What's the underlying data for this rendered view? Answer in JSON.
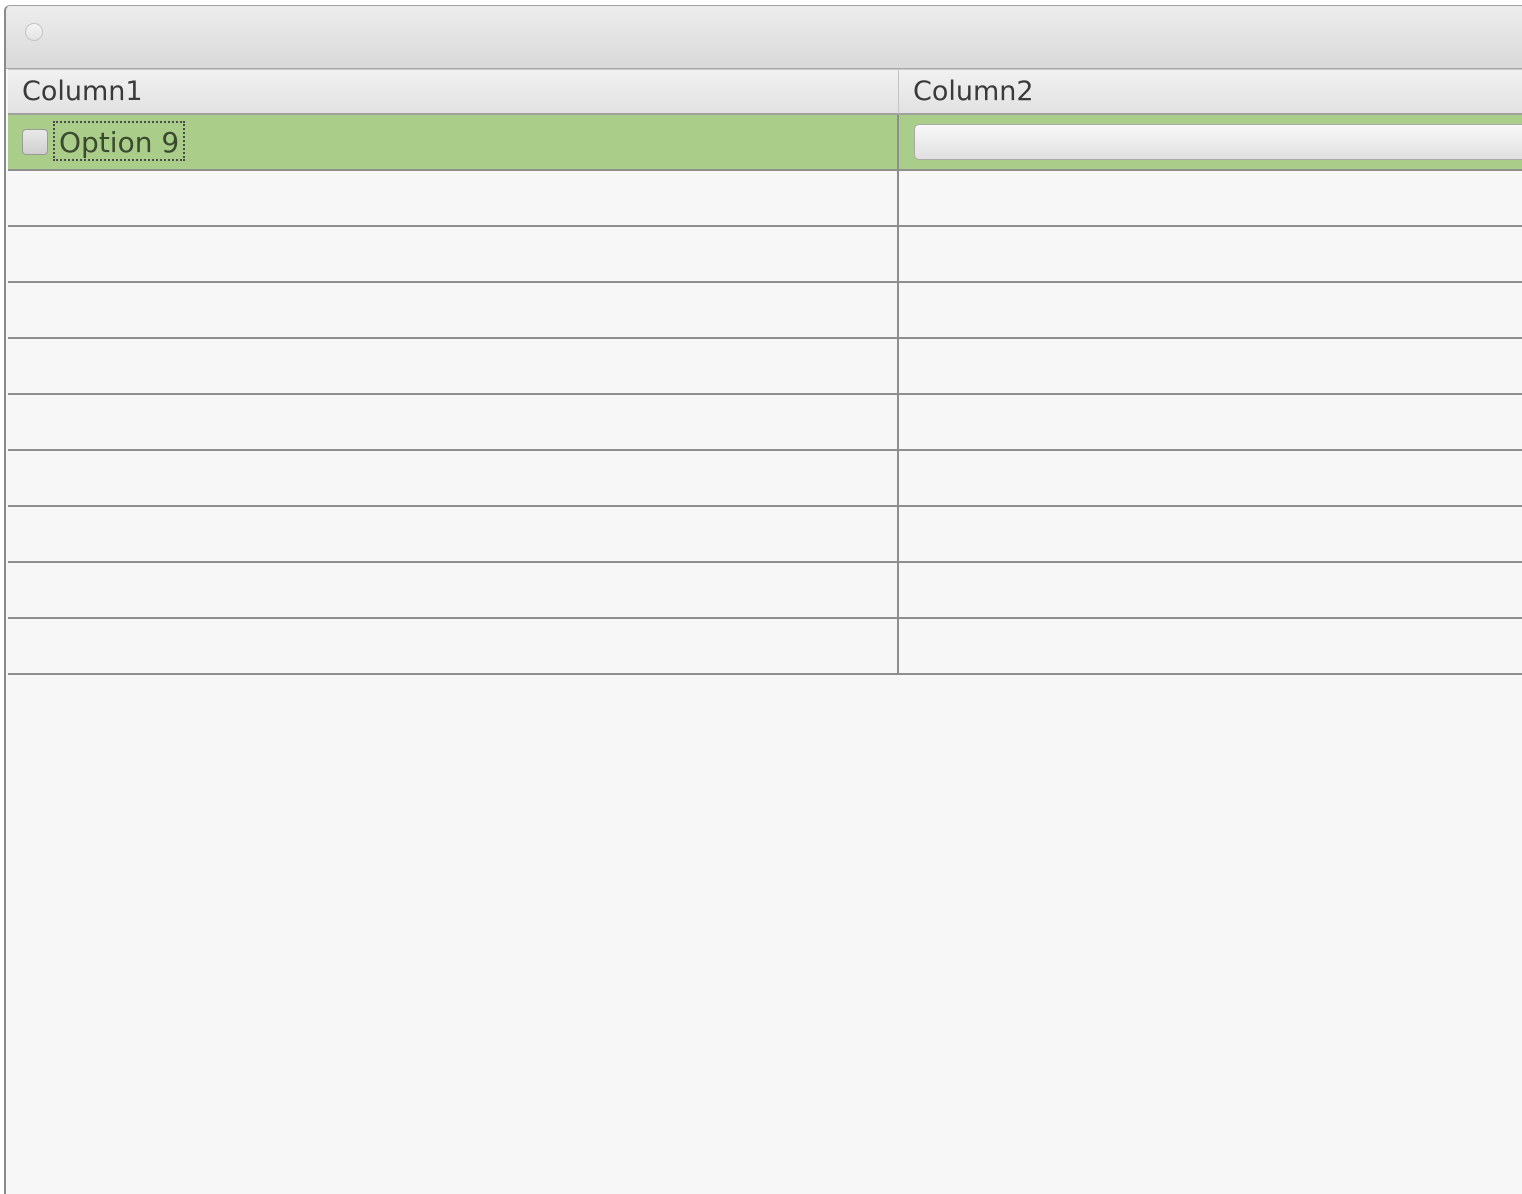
{
  "window": {
    "title": ""
  },
  "table": {
    "columns": [
      "Column1",
      "Column2"
    ],
    "rows": [
      {
        "selected": true,
        "checkbox_checked": false,
        "label": "Option 9",
        "button_label": ""
      },
      {
        "selected": false,
        "label": ""
      },
      {
        "selected": false,
        "label": ""
      },
      {
        "selected": false,
        "label": ""
      },
      {
        "selected": false,
        "label": ""
      },
      {
        "selected": false,
        "label": ""
      },
      {
        "selected": false,
        "label": ""
      },
      {
        "selected": false,
        "label": ""
      },
      {
        "selected": false,
        "label": ""
      },
      {
        "selected": false,
        "label": ""
      }
    ]
  },
  "colors": {
    "selected_row": "#abcd8a",
    "background": "#f7f7f7"
  }
}
